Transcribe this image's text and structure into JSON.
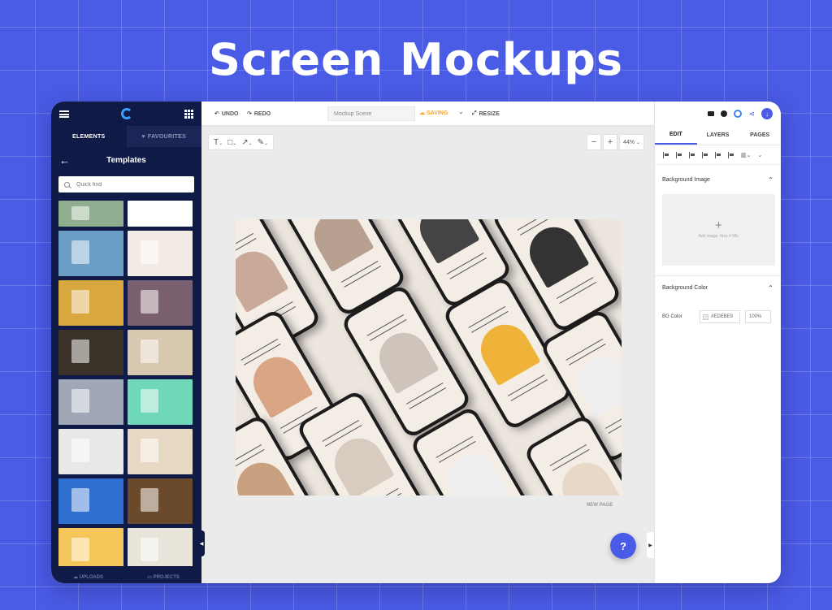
{
  "headline": "Screen Mockups",
  "left_panel": {
    "tabs": [
      "ELEMENTS",
      "FAVOURITES"
    ],
    "title": "Templates",
    "search_placeholder": "Quick find",
    "bottom_tabs": [
      "UPLOADS",
      "PROJECTS"
    ],
    "thumbnail_colors": [
      "#8fae8f",
      "#ffffff",
      "#6b9ec6",
      "#f2ebe6",
      "#d8a73e",
      "#7a5f6e",
      "#3a3228",
      "#d9c8b0",
      "#a0a8b8",
      "#6fd8b8",
      "#e8e8e8",
      "#e8d9c4",
      "#2f6fd0",
      "#6a4a2a",
      "#f5c75a",
      "#e9e4da"
    ]
  },
  "toolbar": {
    "undo": "UNDO",
    "redo": "REDO",
    "scene_name": "Mockup Scene",
    "saving": "SAVING",
    "resize": "RESIZE",
    "zoom_minus": "−",
    "zoom_plus": "+",
    "zoom_level": "44%"
  },
  "canvas": {
    "new_page": "NEW PAGE",
    "help": "?"
  },
  "right_panel": {
    "tabs": [
      "EDIT",
      "LAYERS",
      "PAGES"
    ],
    "background_image": {
      "title": "Background Image",
      "hint": "Add image. Max 4 Mb."
    },
    "background_color": {
      "title": "Background Color",
      "label": "BG Color",
      "value": "#EDEBE9",
      "opacity": "100%"
    }
  },
  "colors": {
    "accent": "#4a5be6",
    "sidebar": "#0f1a46",
    "saving": "#f5a623"
  }
}
